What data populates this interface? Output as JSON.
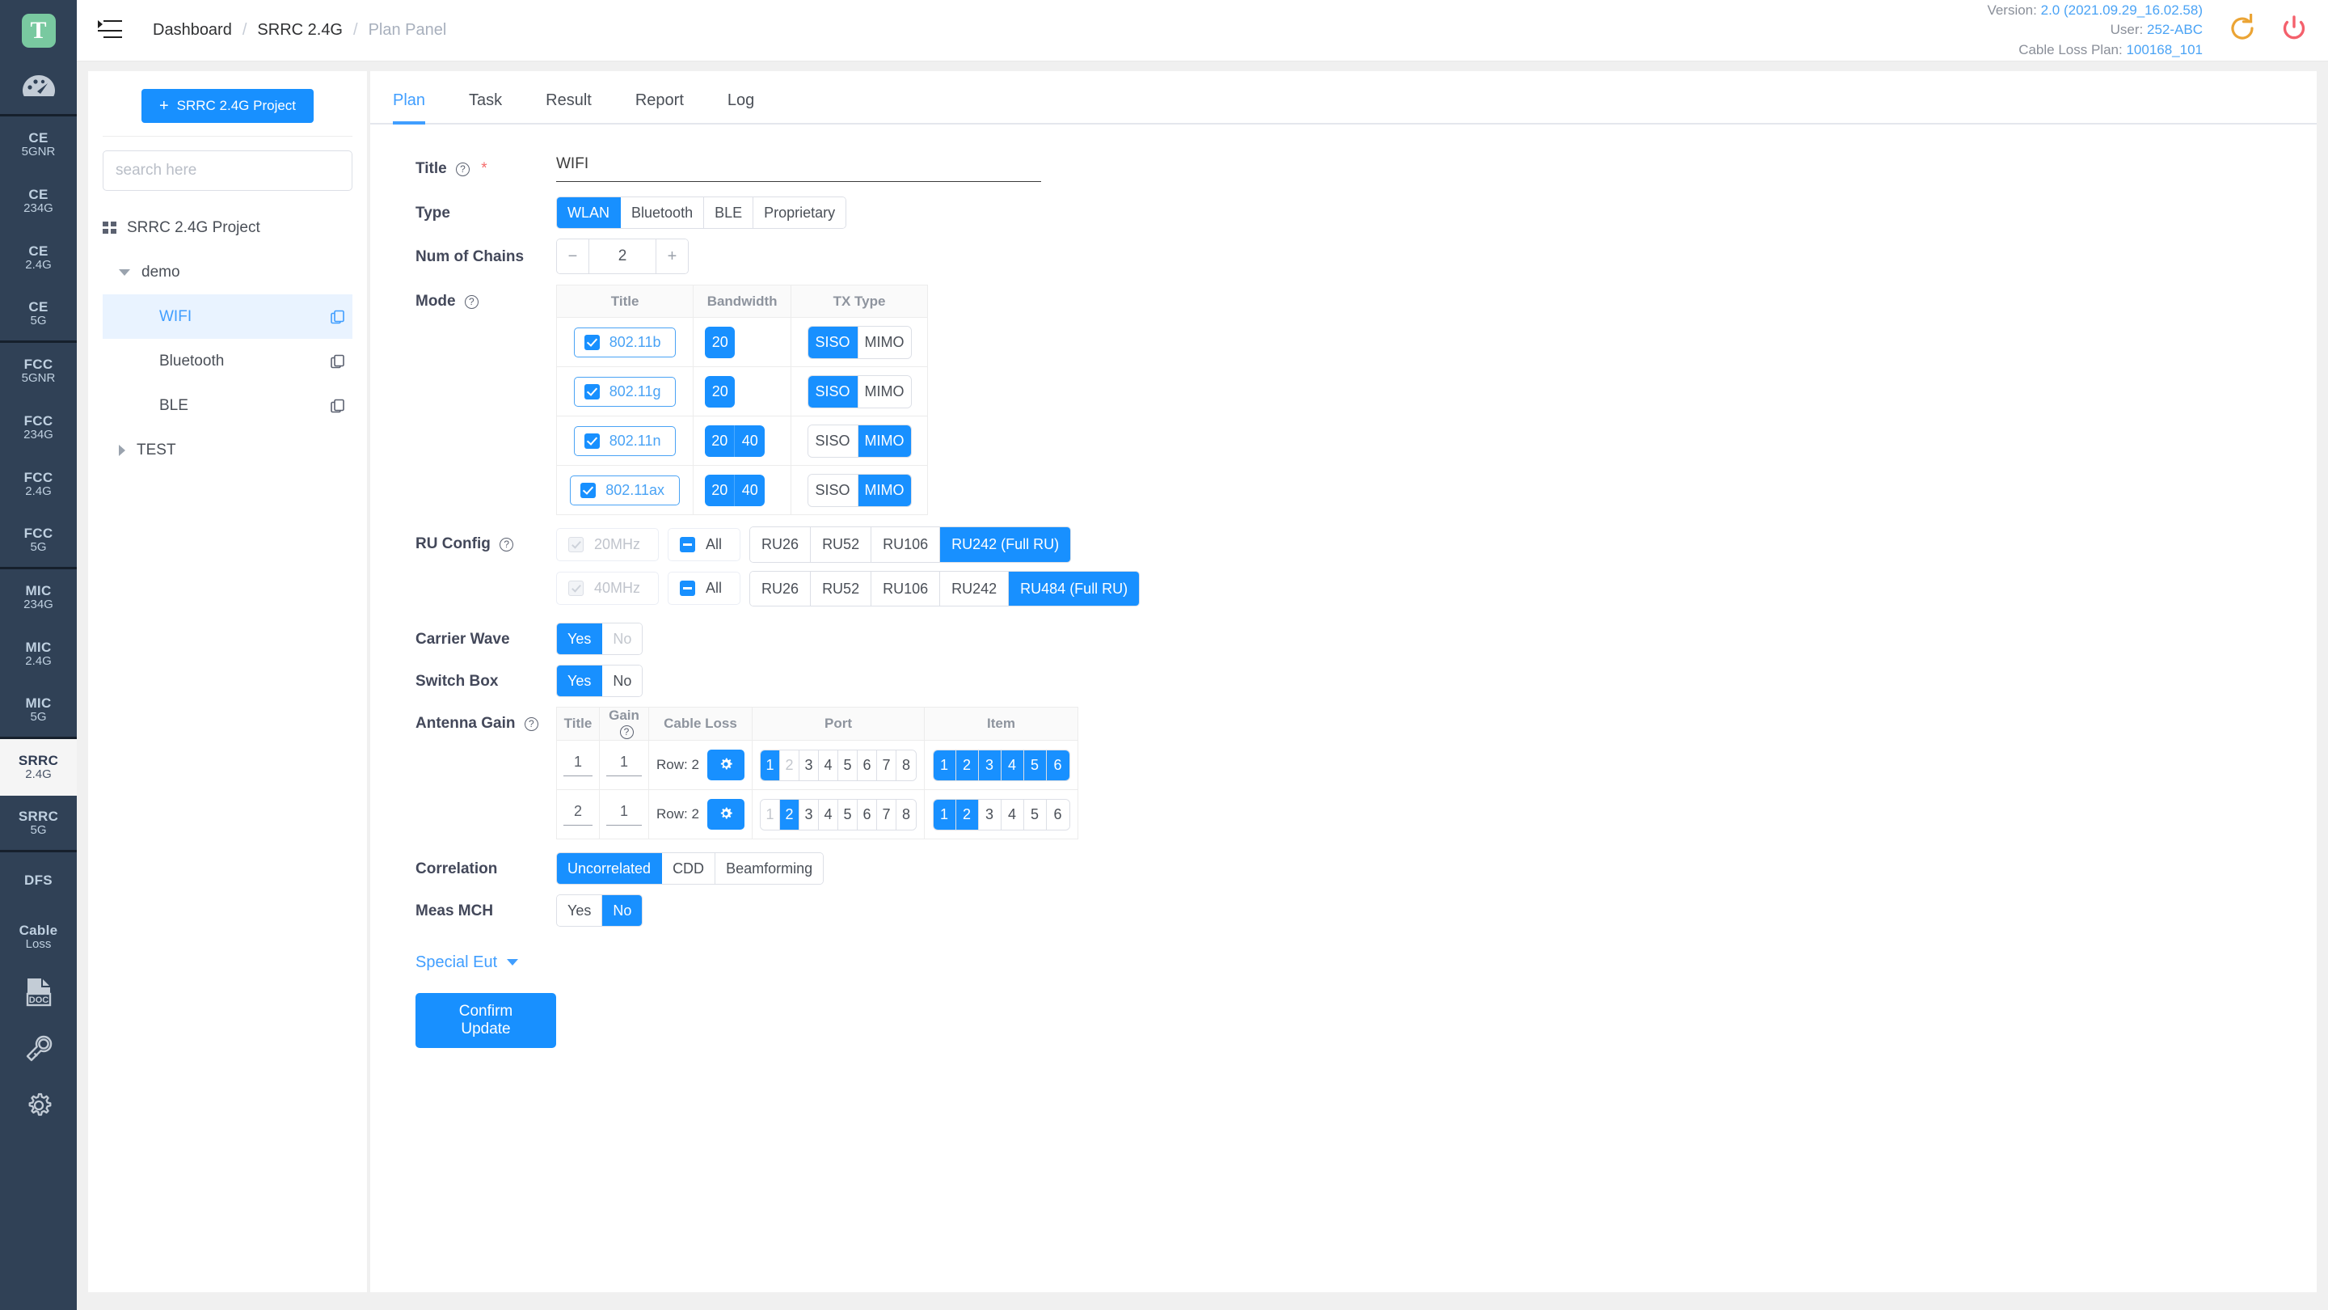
{
  "rail": {
    "logo": "T",
    "dashboard_icon": "dashboard-icon",
    "items": [
      {
        "l1": "CE",
        "l2": "5GNR",
        "active": false,
        "group_end": false
      },
      {
        "l1": "CE",
        "l2": "234G",
        "active": false,
        "group_end": false
      },
      {
        "l1": "CE",
        "l2": "2.4G",
        "active": false,
        "group_end": false
      },
      {
        "l1": "CE",
        "l2": "5G",
        "active": false,
        "group_end": true
      },
      {
        "l1": "FCC",
        "l2": "5GNR",
        "active": false,
        "group_end": false
      },
      {
        "l1": "FCC",
        "l2": "234G",
        "active": false,
        "group_end": false
      },
      {
        "l1": "FCC",
        "l2": "2.4G",
        "active": false,
        "group_end": false
      },
      {
        "l1": "FCC",
        "l2": "5G",
        "active": false,
        "group_end": true
      },
      {
        "l1": "MIC",
        "l2": "234G",
        "active": false,
        "group_end": false
      },
      {
        "l1": "MIC",
        "l2": "2.4G",
        "active": false,
        "group_end": false
      },
      {
        "l1": "MIC",
        "l2": "5G",
        "active": false,
        "group_end": true
      },
      {
        "l1": "SRRC",
        "l2": "2.4G",
        "active": true,
        "group_end": false
      },
      {
        "l1": "SRRC",
        "l2": "5G",
        "active": false,
        "group_end": true
      },
      {
        "l1": "DFS",
        "l2": "",
        "active": false,
        "group_end": false
      },
      {
        "l1": "Cable",
        "l2": "Loss",
        "active": false,
        "group_end": false
      }
    ],
    "bottom_icons": [
      "doc-icon",
      "wrench-icon",
      "gear-icon"
    ]
  },
  "topbar": {
    "menu_icon": "menu-collapse-icon",
    "breadcrumb": [
      {
        "label": "Dashboard",
        "muted": false
      },
      {
        "label": "SRRC 2.4G",
        "muted": false
      },
      {
        "label": "Plan Panel",
        "muted": true
      }
    ],
    "separator": "/",
    "meta": [
      {
        "key": "Version:",
        "value": "2.0 (2021.09.29_16.02.58)"
      },
      {
        "key": "User:",
        "value": "252-ABC"
      },
      {
        "key": "Cable Loss Plan:",
        "value": "100168_101"
      }
    ],
    "refresh_icon": "refresh-icon",
    "power_icon": "power-icon",
    "refresh_color": "#eba434",
    "power_color": "#f4606c"
  },
  "tree_panel": {
    "new_project_label": "SRRC 2.4G Project",
    "new_project_plus": "+",
    "search_placeholder": "search here",
    "search_value": "",
    "root": {
      "label": "SRRC 2.4G Project",
      "icon": "grid-icon"
    },
    "nodes": [
      {
        "label": "demo",
        "level": 1,
        "caret": "down",
        "selected": false,
        "copy": false
      },
      {
        "label": "WIFI",
        "level": 2,
        "caret": "none",
        "selected": true,
        "copy": true
      },
      {
        "label": "Bluetooth",
        "level": 2,
        "caret": "none",
        "selected": false,
        "copy": true
      },
      {
        "label": "BLE",
        "level": 2,
        "caret": "none",
        "selected": false,
        "copy": true
      },
      {
        "label": "TEST",
        "level": 1,
        "caret": "right",
        "selected": false,
        "copy": false
      }
    ]
  },
  "tabs": [
    {
      "label": "Plan",
      "active": true
    },
    {
      "label": "Task",
      "active": false
    },
    {
      "label": "Result",
      "active": false
    },
    {
      "label": "Report",
      "active": false
    },
    {
      "label": "Log",
      "active": false
    }
  ],
  "form": {
    "title": {
      "label": "Title",
      "required_mark": "*",
      "value": "WIFI"
    },
    "type": {
      "label": "Type",
      "options": [
        "WLAN",
        "Bluetooth",
        "BLE",
        "Proprietary"
      ],
      "selected": "WLAN"
    },
    "num_of_chains": {
      "label": "Num of Chains",
      "value": "2",
      "minus": "−",
      "plus": "+"
    },
    "mode": {
      "label": "Mode",
      "columns": [
        "Title",
        "Bandwidth",
        "TX Type"
      ],
      "rows": [
        {
          "title": "802.11b",
          "checked": true,
          "bandwidths": [
            {
              "label": "20",
              "on": true
            }
          ],
          "tx": [
            {
              "label": "SISO",
              "on": true
            },
            {
              "label": "MIMO",
              "on": false
            }
          ]
        },
        {
          "title": "802.11g",
          "checked": true,
          "bandwidths": [
            {
              "label": "20",
              "on": true
            }
          ],
          "tx": [
            {
              "label": "SISO",
              "on": true
            },
            {
              "label": "MIMO",
              "on": false
            }
          ]
        },
        {
          "title": "802.11n",
          "checked": true,
          "bandwidths": [
            {
              "label": "20",
              "on": true
            },
            {
              "label": "40",
              "on": true
            }
          ],
          "tx": [
            {
              "label": "SISO",
              "on": false
            },
            {
              "label": "MIMO",
              "on": true
            }
          ]
        },
        {
          "title": "802.11ax",
          "checked": true,
          "bandwidths": [
            {
              "label": "20",
              "on": true
            },
            {
              "label": "40",
              "on": true
            }
          ],
          "tx": [
            {
              "label": "SISO",
              "on": false
            },
            {
              "label": "MIMO",
              "on": true
            }
          ]
        }
      ]
    },
    "ru_config": {
      "label": "RU Config",
      "rows": [
        {
          "bw_label": "20MHz",
          "all_label": "All",
          "options": [
            {
              "label": "RU26",
              "on": false
            },
            {
              "label": "RU52",
              "on": false
            },
            {
              "label": "RU106",
              "on": false
            },
            {
              "label": "RU242 (Full RU)",
              "on": true
            }
          ]
        },
        {
          "bw_label": "40MHz",
          "all_label": "All",
          "options": [
            {
              "label": "RU26",
              "on": false
            },
            {
              "label": "RU52",
              "on": false
            },
            {
              "label": "RU106",
              "on": false
            },
            {
              "label": "RU242",
              "on": false
            },
            {
              "label": "RU484 (Full RU)",
              "on": true
            }
          ]
        }
      ]
    },
    "carrier_wave": {
      "label": "Carrier Wave",
      "options": [
        {
          "label": "Yes",
          "on": true,
          "dim": false
        },
        {
          "label": "No",
          "on": false,
          "dim": true
        }
      ]
    },
    "switch_box": {
      "label": "Switch Box",
      "options": [
        {
          "label": "Yes",
          "on": true,
          "dim": false
        },
        {
          "label": "No",
          "on": false,
          "dim": false
        }
      ]
    },
    "antenna_gain": {
      "label": "Antenna Gain",
      "columns": [
        "Title",
        "Gain",
        "Cable Loss",
        "Port",
        "Item"
      ],
      "rows": [
        {
          "title": "1",
          "gain": "1",
          "cable_loss_text": "Row: 2",
          "cable_loss_icon": "gear-icon",
          "ports": [
            {
              "label": "1",
              "on": true,
              "dim": false
            },
            {
              "label": "2",
              "on": false,
              "dim": true
            },
            {
              "label": "3",
              "on": false,
              "dim": false
            },
            {
              "label": "4",
              "on": false,
              "dim": false
            },
            {
              "label": "5",
              "on": false,
              "dim": false
            },
            {
              "label": "6",
              "on": false,
              "dim": false
            },
            {
              "label": "7",
              "on": false,
              "dim": false
            },
            {
              "label": "8",
              "on": false,
              "dim": false
            }
          ],
          "items": [
            {
              "label": "1",
              "on": true,
              "dim": false
            },
            {
              "label": "2",
              "on": true,
              "dim": false
            },
            {
              "label": "3",
              "on": true,
              "dim": false
            },
            {
              "label": "4",
              "on": true,
              "dim": false
            },
            {
              "label": "5",
              "on": true,
              "dim": false
            },
            {
              "label": "6",
              "on": true,
              "dim": false
            }
          ]
        },
        {
          "title": "2",
          "gain": "1",
          "cable_loss_text": "Row: 2",
          "cable_loss_icon": "gear-icon",
          "ports": [
            {
              "label": "1",
              "on": false,
              "dim": true
            },
            {
              "label": "2",
              "on": true,
              "dim": false
            },
            {
              "label": "3",
              "on": false,
              "dim": false
            },
            {
              "label": "4",
              "on": false,
              "dim": false
            },
            {
              "label": "5",
              "on": false,
              "dim": false
            },
            {
              "label": "6",
              "on": false,
              "dim": false
            },
            {
              "label": "7",
              "on": false,
              "dim": false
            },
            {
              "label": "8",
              "on": false,
              "dim": false
            }
          ],
          "items": [
            {
              "label": "1",
              "on": true,
              "dim": false
            },
            {
              "label": "2",
              "on": true,
              "dim": false
            },
            {
              "label": "3",
              "on": false,
              "dim": false
            },
            {
              "label": "4",
              "on": false,
              "dim": false
            },
            {
              "label": "5",
              "on": false,
              "dim": false
            },
            {
              "label": "6",
              "on": false,
              "dim": false
            }
          ]
        }
      ]
    },
    "correlation": {
      "label": "Correlation",
      "options": [
        {
          "label": "Uncorrelated",
          "on": true
        },
        {
          "label": "CDD",
          "on": false
        },
        {
          "label": "Beamforming",
          "on": false
        }
      ]
    },
    "meas_mch": {
      "label": "Meas MCH",
      "options": [
        {
          "label": "Yes",
          "on": false
        },
        {
          "label": "No",
          "on": true
        }
      ]
    },
    "special_eut": {
      "label": "Special Eut"
    },
    "confirm_label": "Confirm Update"
  },
  "colors": {
    "accent": "#1890ff",
    "link": "#409eff",
    "rail_bg": "#304156",
    "danger": "#f4606c",
    "warning": "#eba434"
  }
}
